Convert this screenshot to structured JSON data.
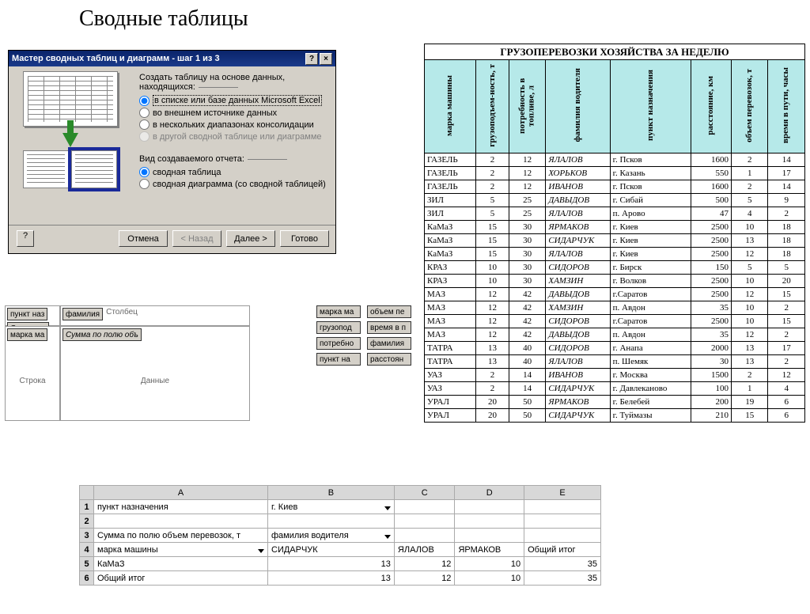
{
  "page_title": "Сводные таблицы",
  "wizard": {
    "title": "Мастер сводных таблиц и диаграмм - шаг 1 из 3",
    "help_icon": "?",
    "close_icon": "×",
    "group1_label": "Создать таблицу на основе данных, находящихся:",
    "opt1": "в списке или базе данных Microsoft Excel",
    "opt2": "во внешнем источнике данных",
    "opt3": "в нескольких диапазонах консолидации",
    "opt4": "в другой сводной таблице или диаграмме",
    "group2_label": "Вид создаваемого отчета:",
    "opt5": "сводная таблица",
    "opt6": "сводная диаграмма (со сводной таблицей)",
    "btn_cancel": "Отмена",
    "btn_back": "< Назад",
    "btn_next": "Далее >",
    "btn_finish": "Готово",
    "btn_help": "?"
  },
  "layout": {
    "page_field": "пункт наз",
    "page_field2": "Страница",
    "col_dropped": "фамилия",
    "col_label": "Столбец",
    "row_dropped": "марка ма",
    "row_label": "Строка",
    "data_dropped": "Сумма по полю объ",
    "data_label": "Данные",
    "fields": [
      "марка ма",
      "объем пе",
      "грузопод",
      "время в п",
      "потребно",
      "фамилия",
      "пункт на",
      "расстоян"
    ]
  },
  "chart_data": {
    "title": "ГРУЗОПЕРЕВОЗКИ  ХОЗЯЙСТВА ЗА НЕДЕЛЮ",
    "type": "table",
    "columns": [
      "марка машины",
      "грузоподъем-ность, т",
      "потребность в топливе, л",
      "фамилия водителя",
      "пункт назначения",
      "расстояние, км",
      "объем перевозок, т",
      "время в пути, часы"
    ],
    "rows": [
      [
        "ГАЗЕЛЬ",
        "2",
        "12",
        "ЯЛАЛОВ",
        "г. Псков",
        "1600",
        "2",
        "14"
      ],
      [
        "ГАЗЕЛЬ",
        "2",
        "12",
        "ХОРЬКОВ",
        "г. Казань",
        "550",
        "1",
        "17"
      ],
      [
        "ГАЗЕЛЬ",
        "2",
        "12",
        "ИВАНОВ",
        "г. Псков",
        "1600",
        "2",
        "14"
      ],
      [
        "ЗИЛ",
        "5",
        "25",
        "ДАВЫДОВ",
        "г. Сибай",
        "500",
        "5",
        "9"
      ],
      [
        "ЗИЛ",
        "5",
        "25",
        "ЯЛАЛОВ",
        "п. Арово",
        "47",
        "4",
        "2"
      ],
      [
        "КаМаЗ",
        "15",
        "30",
        "ЯРМАКОВ",
        "г. Киев",
        "2500",
        "10",
        "18"
      ],
      [
        "КаМаЗ",
        "15",
        "30",
        "СИДАРЧУК",
        "г. Киев",
        "2500",
        "13",
        "18"
      ],
      [
        "КаМаЗ",
        "15",
        "30",
        "ЯЛАЛОВ",
        "г. Киев",
        "2500",
        "12",
        "18"
      ],
      [
        "КРАЗ",
        "10",
        "30",
        "СИДОРОВ",
        "г. Бирск",
        "150",
        "5",
        "5"
      ],
      [
        "КРАЗ",
        "10",
        "30",
        "ХАМЗИН",
        "г. Волков",
        "2500",
        "10",
        "20"
      ],
      [
        "МАЗ",
        "12",
        "42",
        "ДАВЫДОВ",
        "г.Саратов",
        "2500",
        "12",
        "15"
      ],
      [
        "МАЗ",
        "12",
        "42",
        "ХАМЗИН",
        "п. Авдон",
        "35",
        "10",
        "2"
      ],
      [
        "МАЗ",
        "12",
        "42",
        "СИДОРОВ",
        "г.Саратов",
        "2500",
        "10",
        "15"
      ],
      [
        "МАЗ",
        "12",
        "42",
        "ДАВЫДОВ",
        "п. Авдон",
        "35",
        "12",
        "2"
      ],
      [
        "ТАТРА",
        "13",
        "40",
        "СИДОРОВ",
        "г. Анапа",
        "2000",
        "13",
        "17"
      ],
      [
        "ТАТРА",
        "13",
        "40",
        "ЯЛАЛОВ",
        "п. Шемяк",
        "30",
        "13",
        "2"
      ],
      [
        "УАЗ",
        "2",
        "14",
        "ИВАНОВ",
        "г. Москва",
        "1500",
        "2",
        "12"
      ],
      [
        "УАЗ",
        "2",
        "14",
        "СИДАРЧУК",
        "г. Давлеканово",
        "100",
        "1",
        "4"
      ],
      [
        "УРАЛ",
        "20",
        "50",
        "ЯРМАКОВ",
        "г. Белебей",
        "200",
        "19",
        "6"
      ],
      [
        "УРАЛ",
        "20",
        "50",
        "СИДАРЧУК",
        "г. Туймазы",
        "210",
        "15",
        "6"
      ]
    ]
  },
  "pivot": {
    "cols": [
      "",
      "A",
      "B",
      "C",
      "D",
      "E"
    ],
    "rows": [
      [
        "1",
        "пункт назначения",
        "г. Киев",
        "",
        "",
        ""
      ],
      [
        "2",
        "",
        "",
        "",
        "",
        ""
      ],
      [
        "3",
        "Сумма по полю объем перевозок, т",
        "фамилия водителя",
        "",
        "",
        ""
      ],
      [
        "4",
        "марка машины",
        "СИДАРЧУК",
        "ЯЛАЛОВ",
        "ЯРМАКОВ",
        "Общий итог"
      ],
      [
        "5",
        "КаМаЗ",
        "13",
        "12",
        "10",
        "35"
      ],
      [
        "6",
        "Общий итог",
        "13",
        "12",
        "10",
        "35"
      ]
    ]
  }
}
